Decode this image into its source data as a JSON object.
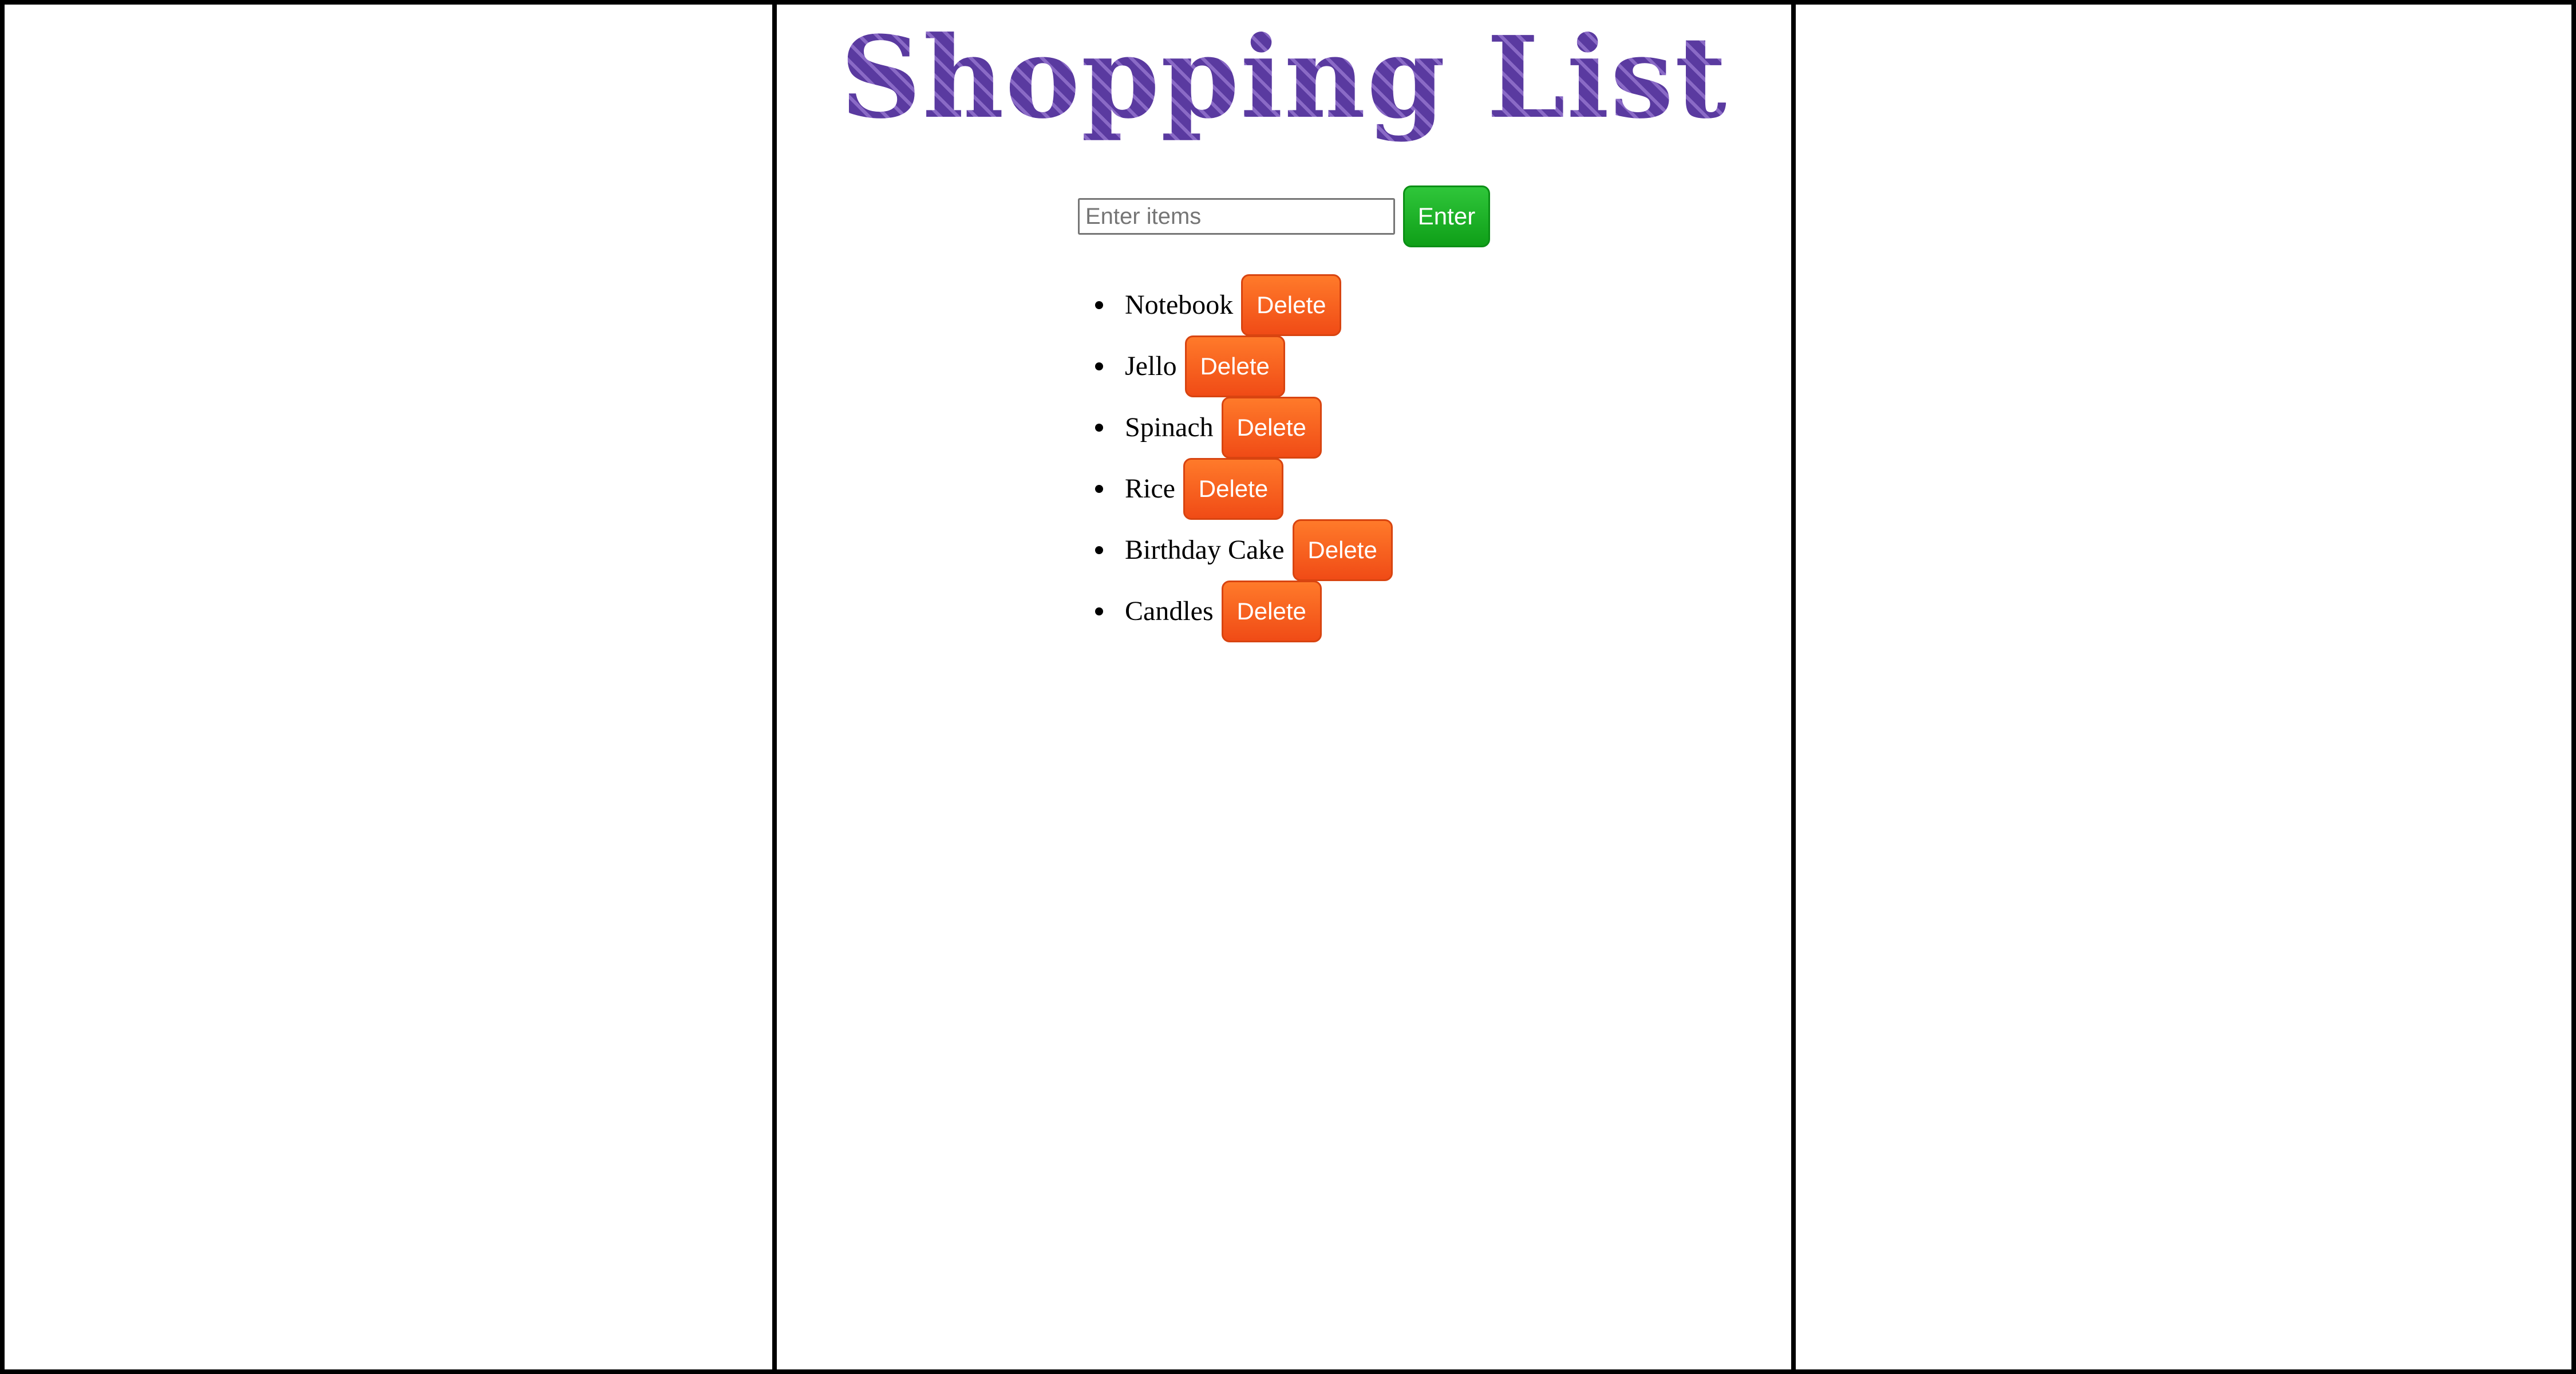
{
  "page": {
    "title": "Shopping List"
  },
  "entry": {
    "placeholder": "Enter items",
    "value": "",
    "enter_label": "Enter"
  },
  "list": {
    "items": [
      {
        "name": "Notebook",
        "delete_label": "Delete"
      },
      {
        "name": "Jello",
        "delete_label": "Delete"
      },
      {
        "name": "Spinach",
        "delete_label": "Delete"
      },
      {
        "name": "Rice",
        "delete_label": "Delete"
      },
      {
        "name": "Birthday Cake",
        "delete_label": "Delete"
      },
      {
        "name": "Candles",
        "delete_label": "Delete"
      }
    ]
  },
  "colors": {
    "title": "#5a3aa0",
    "enter_button": "#17a81f",
    "delete_button": "#f35d1d",
    "border": "#000000"
  },
  "icons": {
    "list_bullet": "bullet-icon"
  }
}
